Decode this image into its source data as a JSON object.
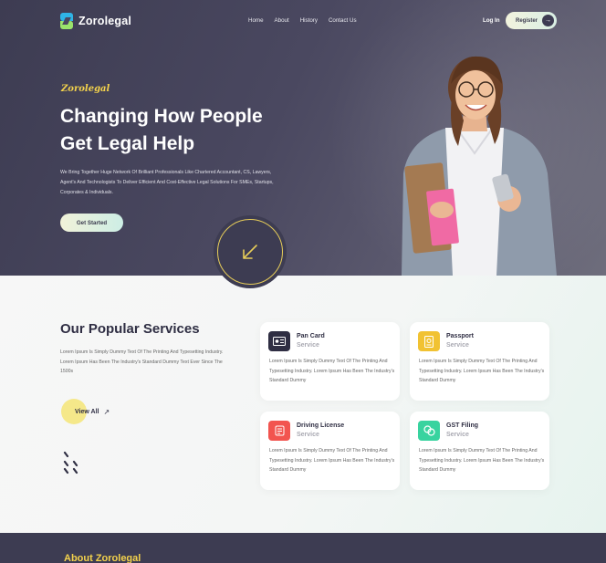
{
  "header": {
    "logo_text": "Zorolegal",
    "nav": [
      "Home",
      "About",
      "History",
      "Contact Us"
    ],
    "login_label": "Log In",
    "register_label": "Register"
  },
  "hero": {
    "brand_script": "Zorolegal",
    "headline_line1": "Changing How People",
    "headline_line2": "Get Legal Help",
    "subtext": "We Bring Together Huge Network Of Brilliant Professionals Like Chartered Accountant, CS, Lawyers, Agent's And Technologists To Deliver Efficient And Cost-Effective Legal Solutions For SMEs, Startups, Corporates & Individuals.",
    "cta_label": "Get Started"
  },
  "services": {
    "title": "Our Popular Services",
    "description": "Lorem Ipsum Is Simply Dummy Text Of The Printing And Typesetting Industry. Lorem Ipsum Has Been The Industry's Standard Dummy Text Ever Since The 1500s",
    "view_all_label": "View All",
    "items": [
      {
        "name": "Pan Card",
        "tag": "Service",
        "icon": "id-card-icon",
        "color": "#2f2e43",
        "text": "Lorem Ipsum Is Simply Dummy Text Of The Printing And Typesetting Industry. Lorem Ipsum Has Been The Industry's Standard Dummy"
      },
      {
        "name": "Passport",
        "tag": "Service",
        "icon": "passport-icon",
        "color": "#f1c232",
        "text": "Lorem Ipsum Is Simply Dummy Text Of The Printing And Typesetting Industry. Lorem Ipsum Has Been The Industry's Standard Dummy"
      },
      {
        "name": "Driving License",
        "tag": "Service",
        "icon": "license-icon",
        "color": "#f2544f",
        "text": "Lorem Ipsum Is Simply Dummy Text Of The Printing And Typesetting Industry. Lorem Ipsum Has Been The Industry's Standard Dummy"
      },
      {
        "name": "GST Filing",
        "tag": "Service",
        "icon": "gst-icon",
        "color": "#38d39f",
        "text": "Lorem Ipsum Is Simply Dummy Text Of The Printing And Typesetting Industry. Lorem Ipsum Has Been The Industry's Standard Dummy"
      }
    ]
  },
  "about": {
    "title": "About Zorolegal"
  }
}
